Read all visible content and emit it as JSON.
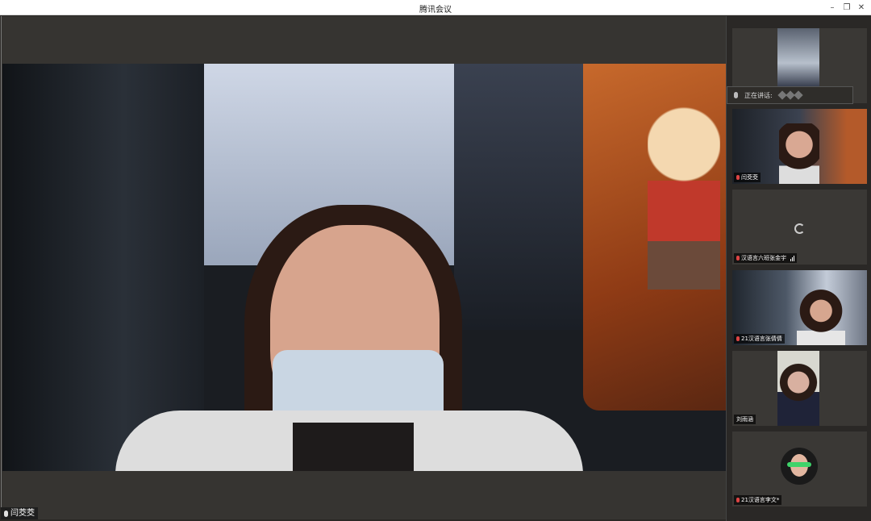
{
  "window": {
    "title": "腾讯会议"
  },
  "controls": {
    "minimize": "–",
    "restore": "❐",
    "close": "✕"
  },
  "main_speaker": {
    "name": "闫茭茭"
  },
  "sidebar": {
    "speaking_label": "正在讲话:",
    "participants": [
      {
        "name": ""
      },
      {
        "name": "闫茭茭"
      },
      {
        "name": "汉语言六班张金宇"
      },
      {
        "name": "21汉语言张倩倩"
      },
      {
        "name": "刘雨涵"
      },
      {
        "name": "21汉语言李文*"
      }
    ]
  },
  "colors": {
    "accent": "#c7692c",
    "mic_muted": "#dd4444"
  }
}
